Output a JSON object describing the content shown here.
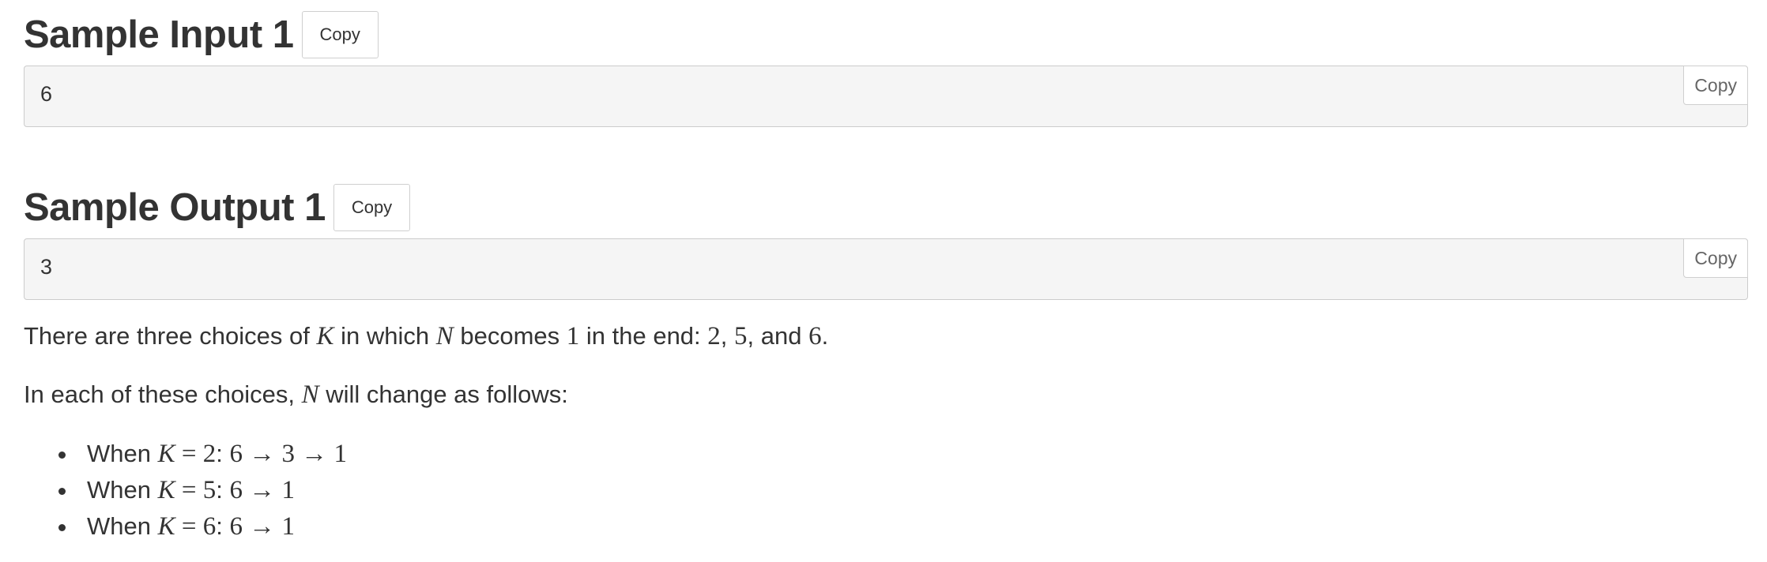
{
  "sample_input": {
    "title": "Sample Input 1",
    "copy_label": "Copy",
    "content": "6",
    "box_copy_label": "Copy"
  },
  "sample_output": {
    "title": "Sample Output 1",
    "copy_label": "Copy",
    "content": "3",
    "box_copy_label": "Copy"
  },
  "explanation": {
    "p1": {
      "t1": "There are three choices of ",
      "m1": "K",
      "t2": " in which ",
      "m2": "N",
      "t3": " becomes ",
      "m3": "1",
      "t4": " in the end: ",
      "m4": "2",
      "t5": ", ",
      "m5": "5",
      "t6": ", and ",
      "m6": "6",
      "t7": "."
    },
    "p2": {
      "t1": "In each of these choices, ",
      "m1": "N",
      "t2": " will change as follows:"
    },
    "bullets": [
      {
        "prefix": "When ",
        "var": "K",
        "eq": " = 2",
        "colon": ": ",
        "seq": "6 → 3 → 1"
      },
      {
        "prefix": "When ",
        "var": "K",
        "eq": " = 5",
        "colon": ": ",
        "seq": "6 → 1"
      },
      {
        "prefix": "When ",
        "var": "K",
        "eq": " = 6",
        "colon": ": ",
        "seq": "6 → 1"
      }
    ]
  }
}
